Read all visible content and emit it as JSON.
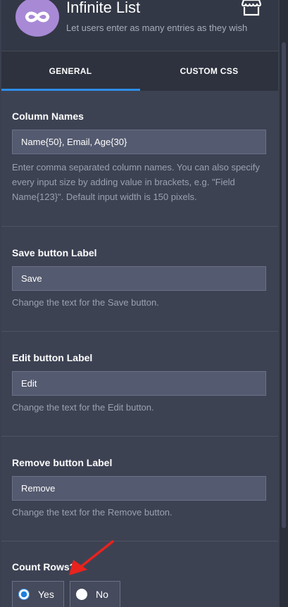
{
  "header": {
    "title": "Infinite List",
    "subtitle": "Let users enter as many entries as they wish",
    "logo_icon": "infinity-icon",
    "action_icon": "store-icon"
  },
  "tabs": [
    {
      "label": "GENERAL",
      "active": true
    },
    {
      "label": "CUSTOM CSS",
      "active": false
    }
  ],
  "sections": {
    "column_names": {
      "label": "Column Names",
      "value": "Name{50}, Email, Age{30}",
      "help": "Enter comma separated column names. You can also specify every input size by adding value in brackets, e.g. \"Field Name{123}\". Default input width is 150 pixels."
    },
    "save_label": {
      "label": "Save button Label",
      "value": "Save",
      "help": "Change the text for the Save button."
    },
    "edit_label": {
      "label": "Edit button Label",
      "value": "Edit",
      "help": "Change the text for the Edit button."
    },
    "remove_label": {
      "label": "Remove button Label",
      "value": "Remove",
      "help": "Change the text for the Remove button."
    },
    "count_rows": {
      "label": "Count Rows?",
      "options": [
        {
          "label": "Yes",
          "selected": true
        },
        {
          "label": "No",
          "selected": false
        }
      ]
    }
  },
  "colors": {
    "accent": "#2e8ee8",
    "logo": "#a889d6",
    "annotation_arrow": "#e8231e"
  }
}
